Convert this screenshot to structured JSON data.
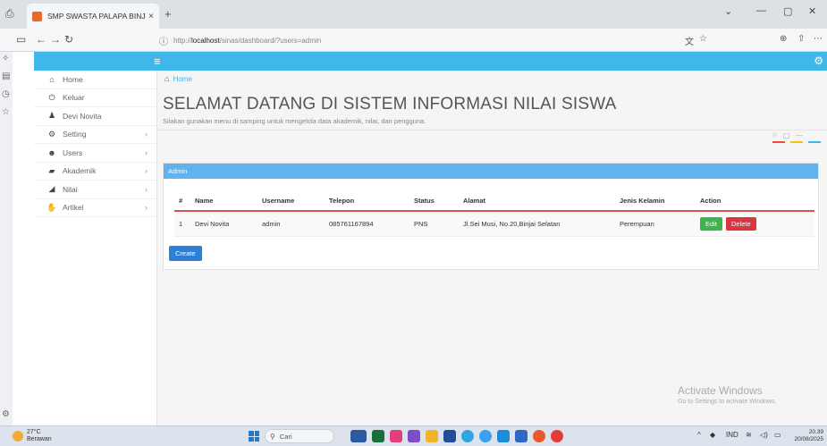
{
  "browser": {
    "tab_title": "SMP SWASTA PALAPA BINJAI",
    "tab_close": "×",
    "new_tab": "+",
    "url_prefix": "http://",
    "url_host": "localhost",
    "url_path": "/sinas/dashboard/?users=admin"
  },
  "sidebar": {
    "items": [
      {
        "label": "Home",
        "icon": "home-icon",
        "has_arrow": false
      },
      {
        "label": "Keluar",
        "icon": "power-icon",
        "has_arrow": false
      },
      {
        "label": "Devi Novita",
        "icon": "user-icon",
        "has_arrow": false
      },
      {
        "label": "Setting",
        "icon": "gear-icon",
        "has_arrow": true
      },
      {
        "label": "Users",
        "icon": "users-icon",
        "has_arrow": true
      },
      {
        "label": "Akademik",
        "icon": "book-icon",
        "has_arrow": true
      },
      {
        "label": "Nilai",
        "icon": "chart-icon",
        "has_arrow": true
      },
      {
        "label": "Artikel",
        "icon": "thumbs-up-icon",
        "has_arrow": true
      }
    ]
  },
  "main": {
    "breadcrumb": "Home",
    "title": "SELAMAT DATANG DI SISTEM INFORMASI NILAI SISWA",
    "subtitle": "Silakan gunakan menu di samping untuk mengelola data akademik, nilai, dan pengguna.",
    "panel_title": "Admin",
    "table": {
      "headers": [
        "#",
        "Name",
        "Username",
        "Telepon",
        "Status",
        "Alamat",
        "Jenis Kelamin",
        "Action"
      ],
      "rows": [
        {
          "no": "1",
          "name": "Devi Novita",
          "username": "admin",
          "telepon": "085761167894",
          "status": "PNS",
          "alamat": "Jl.Sei Musi, No.20,Binjai Selatan",
          "jenis_kelamin": "Perempuan"
        }
      ]
    },
    "edit_label": "Edit",
    "delete_label": "Delete",
    "create_label": "Create"
  },
  "watermark": {
    "line1": "Activate Windows",
    "line2": "Go to Settings to activate Windows."
  },
  "taskbar": {
    "temp": "27°C",
    "weather": "Berawan",
    "search_placeholder": "Cari",
    "lang": "IND",
    "time": "20.39",
    "date": "20/08/2025"
  },
  "colors": {
    "header": "#3fb7e8",
    "panel_head": "#5fb4ef",
    "edit": "#3cb44b",
    "delete": "#d9363e",
    "create": "#2d7fd8"
  }
}
